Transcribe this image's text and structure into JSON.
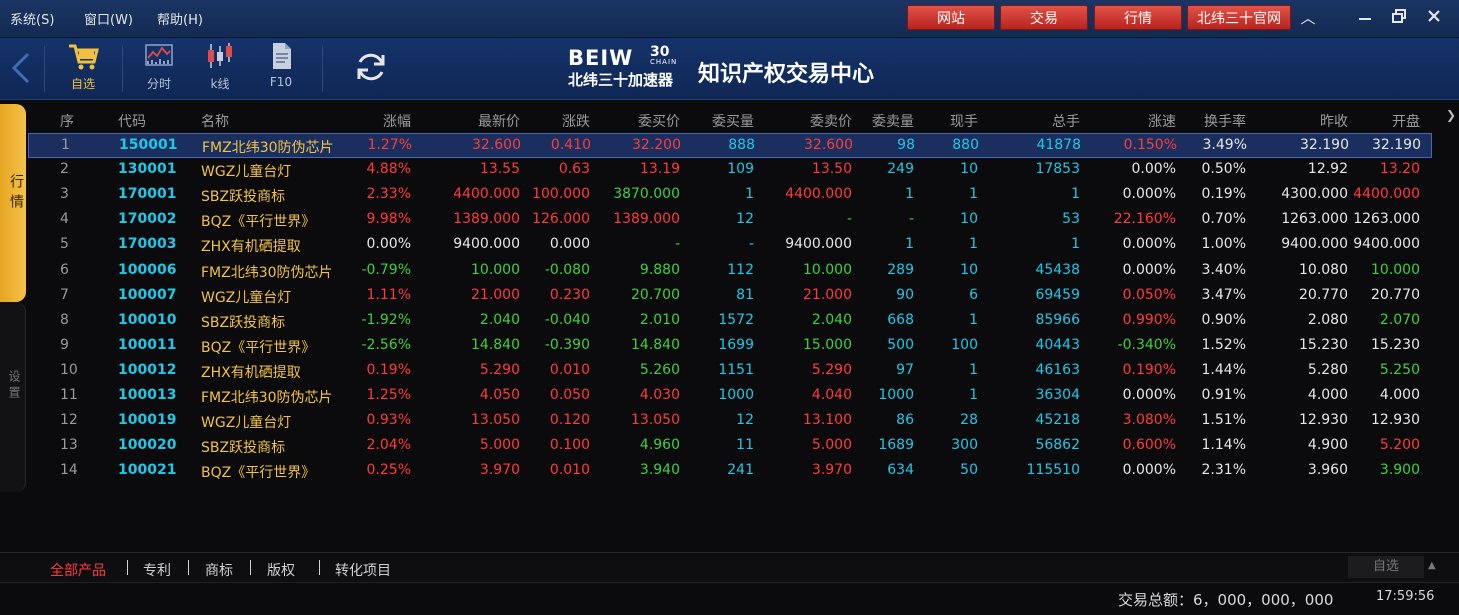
{
  "menu": [
    "系统(S)",
    "窗口(W)",
    "帮助(H)"
  ],
  "top_buttons": [
    "网站",
    "交易",
    "行情",
    "北纬三十官网"
  ],
  "toolbar": {
    "items": [
      "自选",
      "分时",
      "k线",
      "F10"
    ],
    "brand_logo": "BEIW",
    "brand_logo_num": "30",
    "brand_logo_sub": "CHAIN",
    "brand_cn": "北纬三十加速器",
    "brand_title": "知识产权交易中心"
  },
  "side_tabs": [
    "行情",
    "设置"
  ],
  "columns": [
    "序",
    "代码",
    "名称",
    "涨幅",
    "最新价",
    "涨跌",
    "委买价",
    "委买量",
    "委卖价",
    "委卖量",
    "现手",
    "总手",
    "涨速",
    "换手率",
    "昨收",
    "开盘"
  ],
  "rows": [
    [
      "1",
      "150001",
      "FMZ北纬30防伪芯片",
      "1.27%",
      "32.600",
      "0.410",
      "32.200",
      "888",
      "32.600",
      "98",
      "880",
      "41878",
      "0.150%",
      "3.49%",
      "32.190",
      "32.190"
    ],
    [
      "2",
      "130001",
      "WGZ儿童台灯",
      "4.88%",
      "13.55",
      "0.63",
      "13.19",
      "109",
      "13.50",
      "249",
      "10",
      "17853",
      "0.00%",
      "0.50%",
      "12.92",
      "13.20"
    ],
    [
      "3",
      "170001",
      "SBZ跃投商标",
      "2.33%",
      "4400.000",
      "100.000",
      "3870.000",
      "1",
      "4400.000",
      "1",
      "1",
      "1",
      "0.000%",
      "0.19%",
      "4300.000",
      "4400.000"
    ],
    [
      "4",
      "170002",
      "BQZ《平行世界》",
      "9.98%",
      "1389.000",
      "126.000",
      "1389.000",
      "12",
      "-",
      "-",
      "10",
      "53",
      "22.160%",
      "0.70%",
      "1263.000",
      "1263.000"
    ],
    [
      "5",
      "170003",
      "ZHX有机硒提取",
      "0.00%",
      "9400.000",
      "0.000",
      "-",
      "-",
      "9400.000",
      "1",
      "1",
      "1",
      "0.000%",
      "1.00%",
      "9400.000",
      "9400.000"
    ],
    [
      "6",
      "100006",
      "FMZ北纬30防伪芯片",
      "-0.79%",
      "10.000",
      "-0.080",
      "9.880",
      "112",
      "10.000",
      "289",
      "10",
      "45438",
      "0.000%",
      "3.40%",
      "10.080",
      "10.000"
    ],
    [
      "7",
      "100007",
      "WGZ儿童台灯",
      "1.11%",
      "21.000",
      "0.230",
      "20.700",
      "81",
      "21.000",
      "90",
      "6",
      "69459",
      "0.050%",
      "3.47%",
      "20.770",
      "20.770"
    ],
    [
      "8",
      "100010",
      "SBZ跃投商标",
      "-1.92%",
      "2.040",
      "-0.040",
      "2.010",
      "1572",
      "2.040",
      "668",
      "1",
      "85966",
      "0.990%",
      "0.90%",
      "2.080",
      "2.070"
    ],
    [
      "9",
      "100011",
      "BQZ《平行世界》",
      "-2.56%",
      "14.840",
      "-0.390",
      "14.840",
      "1699",
      "15.000",
      "500",
      "100",
      "40443",
      "-0.340%",
      "1.52%",
      "15.230",
      "15.230"
    ],
    [
      "10",
      "100012",
      "ZHX有机硒提取",
      "0.19%",
      "5.290",
      "0.010",
      "5.260",
      "1151",
      "5.290",
      "97",
      "1",
      "46163",
      "0.190%",
      "1.44%",
      "5.280",
      "5.250"
    ],
    [
      "11",
      "100013",
      "FMZ北纬30防伪芯片",
      "1.25%",
      "4.050",
      "0.050",
      "4.030",
      "1000",
      "4.040",
      "1000",
      "1",
      "36304",
      "0.000%",
      "0.91%",
      "4.000",
      "4.000"
    ],
    [
      "12",
      "100019",
      "WGZ儿童台灯",
      "0.93%",
      "13.050",
      "0.120",
      "13.050",
      "12",
      "13.100",
      "86",
      "28",
      "45218",
      "3.080%",
      "1.51%",
      "12.930",
      "12.930"
    ],
    [
      "13",
      "100020",
      "SBZ跃投商标",
      "2.04%",
      "5.000",
      "0.100",
      "4.960",
      "11",
      "5.000",
      "1689",
      "300",
      "56862",
      "0.600%",
      "1.14%",
      "4.900",
      "5.200"
    ],
    [
      "14",
      "100021",
      "BQZ《平行世界》",
      "0.25%",
      "3.970",
      "0.010",
      "3.940",
      "241",
      "3.970",
      "634",
      "50",
      "115510",
      "0.000%",
      "2.31%",
      "3.960",
      "3.900"
    ]
  ],
  "row_colors": [
    [
      "idx",
      "code",
      "name",
      "up",
      "up",
      "up",
      "up",
      "cyan",
      "up",
      "cyan",
      "cyan",
      "cyan",
      "up",
      "flat",
      "flat",
      "flat"
    ],
    [
      "idx",
      "code",
      "name",
      "up",
      "up",
      "up",
      "up",
      "cyan",
      "up",
      "cyan",
      "cyan",
      "cyan",
      "flat",
      "flat",
      "flat",
      "up"
    ],
    [
      "idx",
      "code",
      "name",
      "up",
      "up",
      "up",
      "down",
      "cyan",
      "up",
      "cyan",
      "cyan",
      "cyan",
      "flat",
      "flat",
      "flat",
      "up"
    ],
    [
      "idx",
      "code",
      "name",
      "up",
      "up",
      "up",
      "up",
      "cyan",
      "down",
      "down",
      "cyan",
      "cyan",
      "up",
      "flat",
      "flat",
      "flat"
    ],
    [
      "idx",
      "code",
      "name",
      "flat",
      "flat",
      "flat",
      "down",
      "cyan",
      "flat",
      "cyan",
      "cyan",
      "cyan",
      "flat",
      "flat",
      "flat",
      "flat"
    ],
    [
      "idx",
      "code",
      "name",
      "down",
      "down",
      "down",
      "down",
      "cyan",
      "down",
      "cyan",
      "cyan",
      "cyan",
      "flat",
      "flat",
      "flat",
      "down"
    ],
    [
      "idx",
      "code",
      "name",
      "up",
      "up",
      "up",
      "down",
      "cyan",
      "up",
      "cyan",
      "cyan",
      "cyan",
      "up",
      "flat",
      "flat",
      "flat"
    ],
    [
      "idx",
      "code",
      "name",
      "down",
      "down",
      "down",
      "down",
      "cyan",
      "down",
      "cyan",
      "cyan",
      "cyan",
      "up",
      "flat",
      "flat",
      "down"
    ],
    [
      "idx",
      "code",
      "name",
      "down",
      "down",
      "down",
      "down",
      "cyan",
      "down",
      "cyan",
      "cyan",
      "cyan",
      "down",
      "flat",
      "flat",
      "flat"
    ],
    [
      "idx",
      "code",
      "name",
      "up",
      "up",
      "up",
      "down",
      "cyan",
      "up",
      "cyan",
      "cyan",
      "cyan",
      "up",
      "flat",
      "flat",
      "down"
    ],
    [
      "idx",
      "code",
      "name",
      "up",
      "up",
      "up",
      "up",
      "cyan",
      "up",
      "cyan",
      "cyan",
      "cyan",
      "flat",
      "flat",
      "flat",
      "flat"
    ],
    [
      "idx",
      "code",
      "name",
      "up",
      "up",
      "up",
      "up",
      "cyan",
      "up",
      "cyan",
      "cyan",
      "cyan",
      "up",
      "flat",
      "flat",
      "flat"
    ],
    [
      "idx",
      "code",
      "name",
      "up",
      "up",
      "up",
      "down",
      "cyan",
      "up",
      "cyan",
      "cyan",
      "cyan",
      "up",
      "flat",
      "flat",
      "up"
    ],
    [
      "idx",
      "code",
      "name",
      "up",
      "up",
      "up",
      "down",
      "cyan",
      "up",
      "cyan",
      "cyan",
      "cyan",
      "flat",
      "flat",
      "flat",
      "down"
    ]
  ],
  "selected_row": 0,
  "bottom_tabs": [
    "全部产品",
    "专利",
    "商标",
    "版权",
    "转化项目"
  ],
  "bottom_right_tab": "自选",
  "status": {
    "total_label": "交易总额：6，000，000，000",
    "clock": "17:59:56"
  },
  "colors": {
    "up": "#ff3b3b",
    "down": "#3fd13f",
    "code": "#20c8e8",
    "name": "#f2c345",
    "accent": "#e6a521",
    "header_bg": "#15336a"
  }
}
